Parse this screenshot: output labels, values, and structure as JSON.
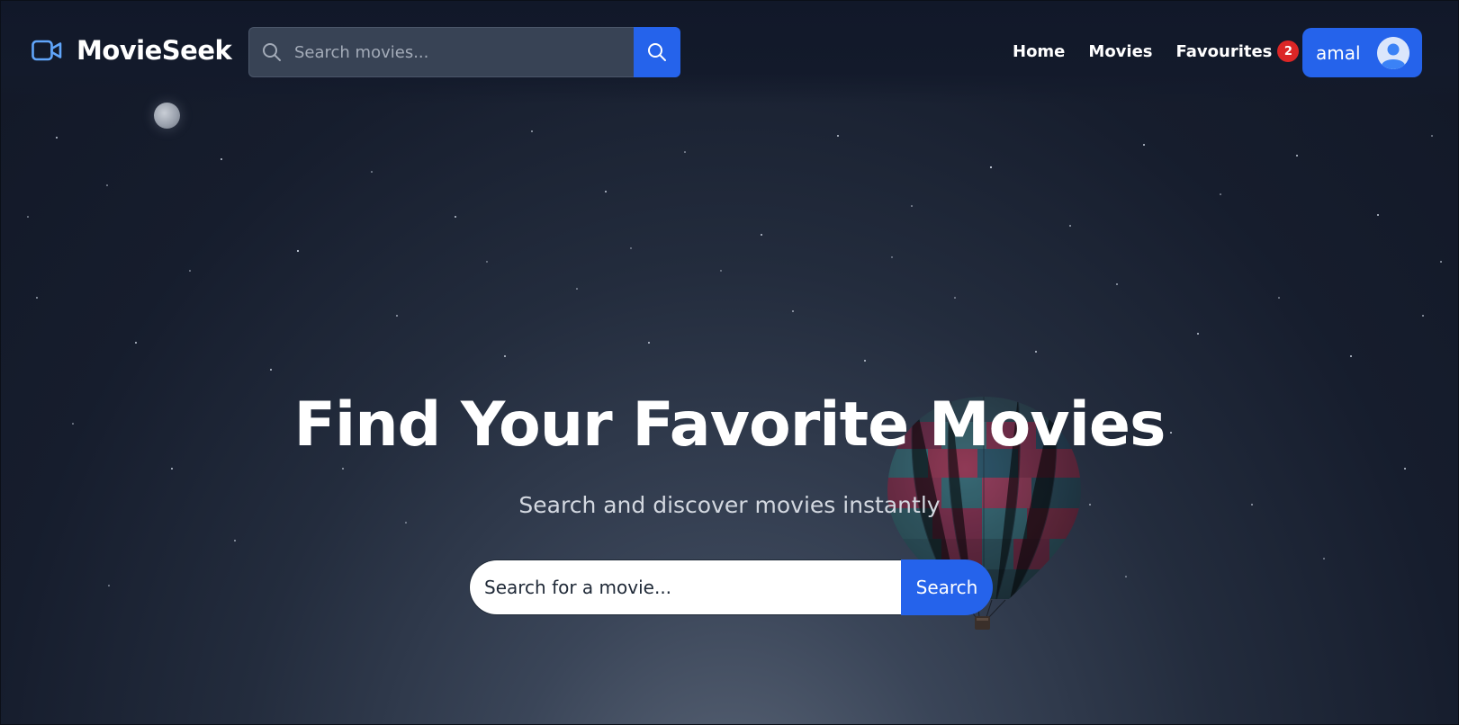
{
  "brand": {
    "name": "MovieSeek",
    "icon": "video-camera-icon"
  },
  "header_search": {
    "placeholder": "Search movies...",
    "button_icon": "search-icon"
  },
  "nav": {
    "items": [
      {
        "label": "Home"
      },
      {
        "label": "Movies"
      },
      {
        "label": "Favourites",
        "badge": "2"
      }
    ]
  },
  "user": {
    "name": "amal",
    "avatar_icon": "user-avatar-icon"
  },
  "hero": {
    "title": "Find Your Favorite Movies",
    "subtitle": "Search and discover movies instantly",
    "search_placeholder": "Search for a movie...",
    "search_button": "Search"
  },
  "colors": {
    "accent": "#2563eb",
    "badge": "#dc2626",
    "background": "#151c2c",
    "text": "#ffffff"
  }
}
